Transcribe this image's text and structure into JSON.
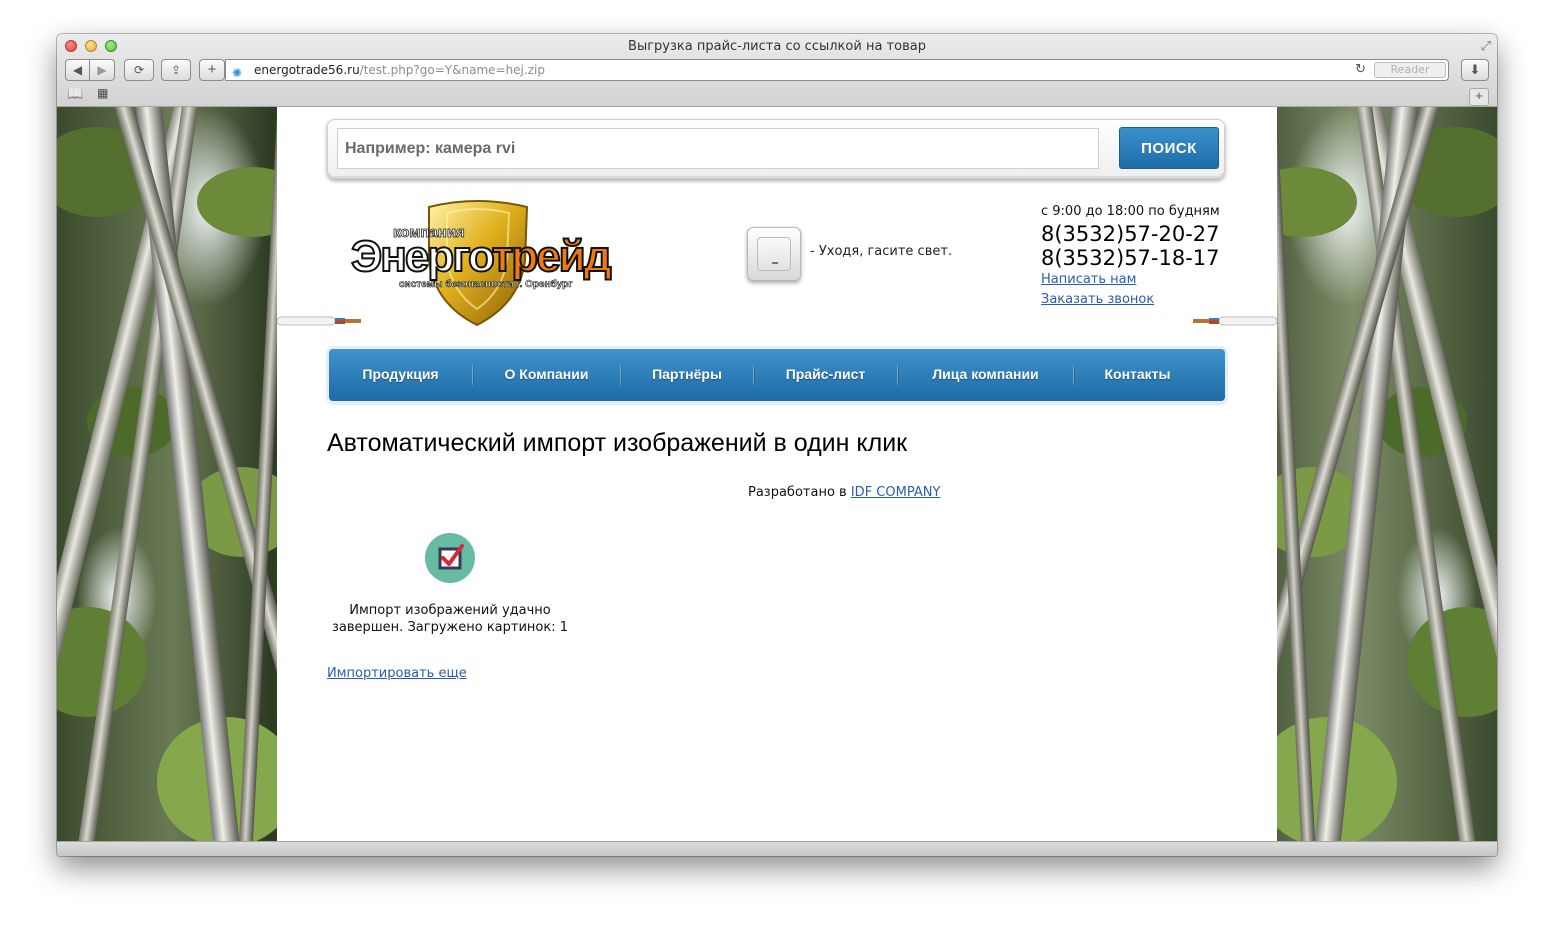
{
  "browser": {
    "window_title": "Выгрузка прайс-листа со ссылкой на товар",
    "url_host": "energotrade56.ru",
    "url_path": "/test.php?go=Y&name=hej.zip",
    "reader_label": "Reader"
  },
  "search": {
    "placeholder": "Например: камера rvi",
    "button_label": "ПОИСК"
  },
  "logo": {
    "top_text": "компания",
    "brand_part1": "Энерго",
    "brand_part2": "трейд",
    "subtitle": "системы безопасности г. Оренбург"
  },
  "header": {
    "tagline": "- Уходя, гасите свет.",
    "hours": "с 9:00 до 18:00 по будням",
    "phone1": "8(3532)57-20-27",
    "phone2": "8(3532)57-18-17",
    "write_us": "Написать нам",
    "callback": "Заказать звонок"
  },
  "nav": {
    "items": [
      {
        "label": "Продукция"
      },
      {
        "label": "О Компании"
      },
      {
        "label": "Партнёры"
      },
      {
        "label": "Прайс-лист"
      },
      {
        "label": "Лица компании"
      },
      {
        "label": "Контакты"
      }
    ]
  },
  "content": {
    "heading": "Автоматический импорт изображений в один клик",
    "developed_prefix": "Разработано в",
    "developed_link": "IDF COMPANY",
    "success_line1": "Импорт изображений удачно",
    "success_line2": "завершен. Загружено картинок: 1",
    "import_more": "Импортировать еще"
  },
  "colors": {
    "accent_blue": "#1f6ca6",
    "link": "#2a5db0",
    "success_icon_bg": "#66bba2",
    "logo_orange": "#f07a12"
  }
}
